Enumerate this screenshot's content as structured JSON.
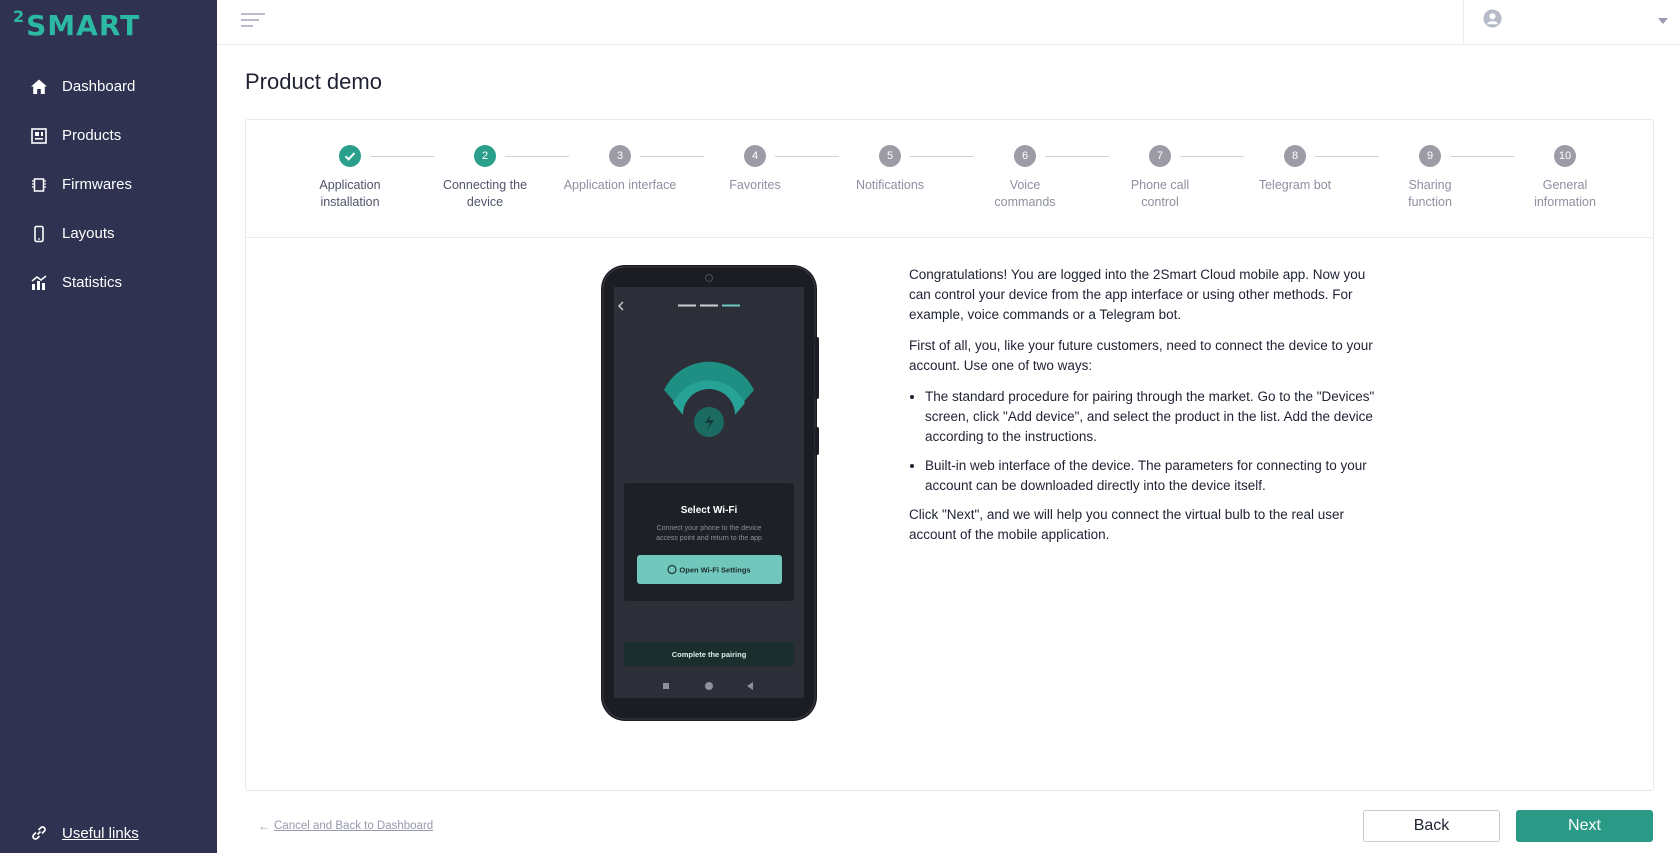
{
  "app": {
    "logo_sup": "2",
    "logo_main": "SMART"
  },
  "sidebar": {
    "items": [
      {
        "label": "Dashboard",
        "icon": "home-icon"
      },
      {
        "label": "Products",
        "icon": "products-icon"
      },
      {
        "label": "Firmwares",
        "icon": "firmware-chip-icon"
      },
      {
        "label": "Layouts",
        "icon": "phone-icon"
      },
      {
        "label": "Statistics",
        "icon": "statistics-icon"
      }
    ],
    "useful_links": "Useful links"
  },
  "page": {
    "title": "Product demo"
  },
  "steps": [
    {
      "number": "1",
      "label": "Application installation",
      "state": "done"
    },
    {
      "number": "2",
      "label": "Connecting the device",
      "state": "active"
    },
    {
      "number": "3",
      "label": "Application interface",
      "state": "pending"
    },
    {
      "number": "4",
      "label": "Favorites",
      "state": "pending"
    },
    {
      "number": "5",
      "label": "Notifications",
      "state": "pending"
    },
    {
      "number": "6",
      "label": "Voice commands",
      "state": "pending"
    },
    {
      "number": "7",
      "label": "Phone call control",
      "state": "pending"
    },
    {
      "number": "8",
      "label": "Telegram bot",
      "state": "pending"
    },
    {
      "number": "9",
      "label": "Sharing function",
      "state": "pending"
    },
    {
      "number": "10",
      "label": "General information",
      "state": "pending"
    }
  ],
  "phone": {
    "dialog_title": "Select Wi-Fi",
    "dialog_text": "Connect your phone to the device access point and return to the app",
    "open_settings_label": "Open Wi-Fi Settings",
    "complete_label": "Complete the pairing"
  },
  "content": {
    "p1": "Congratulations! You are logged into the 2Smart Cloud mobile app. Now you can control your device from the app interface or using other methods. For example, voice commands or a Telegram bot.",
    "p2": "First of all, you, like your future customers, need to connect the device to your account. Use one of two ways:",
    "bullet1": "The standard procedure for pairing through the market. Go to the \"Devices\" screen, click \"Add device\", and select the product in the list. Add the device according to the instructions.",
    "bullet2": "Built-in web interface of the device. The parameters for connecting to your account can be downloaded directly into the device itself.",
    "p3": "Click \"Next\", and we will help you connect the virtual bulb to the real user account of the mobile application."
  },
  "footer": {
    "cancel_label": "Cancel and Back to Dashboard",
    "back_label": "Back",
    "next_label": "Next"
  },
  "colors": {
    "sidebar": "#2f3250",
    "accent": "#2a9a87",
    "logo": "#2bb9a3"
  }
}
